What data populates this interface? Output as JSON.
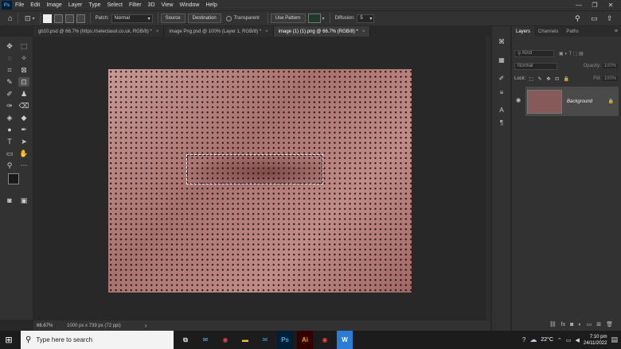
{
  "menu": {
    "logo": "Ps",
    "items": [
      "File",
      "Edit",
      "Image",
      "Layer",
      "Type",
      "Select",
      "Filter",
      "3D",
      "View",
      "Window",
      "Help"
    ],
    "minimize": "—",
    "restore": "❐",
    "close": "✕"
  },
  "options": {
    "patch_label": "Patch:",
    "patch_value": "Normal",
    "source": "Source",
    "destination": "Destination",
    "transparent": "Transparent",
    "use_pattern": "Use Pattern",
    "diffusion_label": "Diffusion:",
    "diffusion_value": "5"
  },
  "tabs": [
    {
      "label": "gb10.psd @ 66.7% (https://selectasol.co.uk, RGB/8) *",
      "close": "×"
    },
    {
      "label": "image Png.psd @ 100% (Layer 1, RGB/8) *",
      "close": "×"
    },
    {
      "label": "image (1) (1).png @ 66.7% (RGB/8) *",
      "close": "×"
    }
  ],
  "status": {
    "zoom": "66.67%",
    "doc_info": "1000 px x 739 px (72 ppi)",
    "arrow": "›"
  },
  "layers_panel": {
    "tabs": [
      "Layers",
      "Channels",
      "Paths"
    ],
    "kind_placeholder": "Kind",
    "blend_mode": "Normal",
    "opacity_label": "Opacity:",
    "opacity_value": "100%",
    "lock_label": "Lock:",
    "fill_label": "Fill:",
    "fill_value": "100%",
    "layer_name": "Background"
  },
  "taskbar": {
    "search_text": "Type here to search",
    "temperature": "22°C",
    "time": "7:10 pm",
    "date": "24/11/2022",
    "apps": [
      "Ps",
      "Ai",
      "W"
    ]
  },
  "colors": {
    "accent_ps": "#31a8ff",
    "ai_orange": "#ff9a00",
    "word_blue": "#2b7cd3"
  }
}
